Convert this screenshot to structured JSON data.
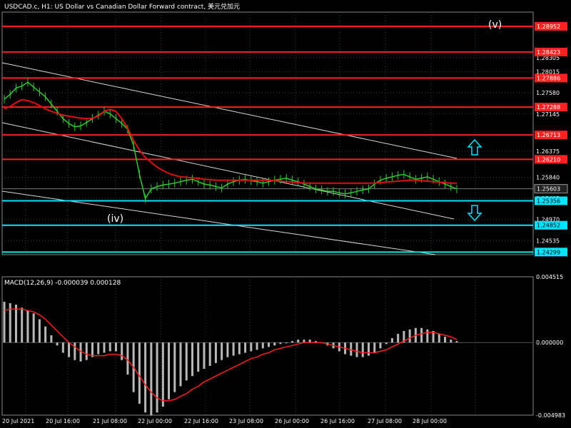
{
  "header": {
    "title": "USDCAD.c, H1:  US Dollar vs Canadian Dollar Forward contract, 美元兑加元"
  },
  "annotations": {
    "wave_v": "(v)",
    "wave_iv": "(iv)"
  },
  "macd": {
    "label": "MACD(12,26,9) -0.000039 0.000128"
  },
  "colors": {
    "background": "#000000",
    "grid": "#3a3a3a",
    "candle_up": "#2ecc2e",
    "ma_line": "#e01010",
    "resistance": "#ff2020",
    "support": "#00e5ff",
    "channel": "#d8d8d8",
    "macd_hist": "#b8b8b8",
    "macd_signal": "#ff2020",
    "text": "#ffffff",
    "arrow": "#00e5ff"
  },
  "chart_data": {
    "type": "line",
    "price_axis": {
      "ticks": [
        "1.28305",
        "1.28015",
        "1.27580",
        "1.27145",
        "1.26375",
        "1.25840",
        "1.25405",
        "1.24970",
        "1.24535"
      ]
    },
    "time_axis": {
      "ticks": [
        "20 Jul 2021",
        "20 Jul 16:00",
        "21 Jul 08:00",
        "22 Jul 00:00",
        "22 Jul 16:00",
        "23 Jul 08:00",
        "26 Jul 00:00",
        "26 Jul 16:00",
        "27 Jul 08:00",
        "28 Jul 00:00"
      ]
    },
    "levels": [
      {
        "value": 1.28952,
        "label": "1.28952",
        "kind": "resistance"
      },
      {
        "value": 1.28423,
        "label": "1.28423",
        "kind": "resistance"
      },
      {
        "value": 1.27886,
        "label": "1.27886",
        "kind": "resistance"
      },
      {
        "value": 1.27288,
        "label": "1.27288",
        "kind": "resistance"
      },
      {
        "value": 1.26713,
        "label": "1.26713",
        "kind": "resistance"
      },
      {
        "value": 1.2621,
        "label": "1.26210",
        "kind": "resistance"
      },
      {
        "value": 1.25356,
        "label": "1.25356",
        "kind": "support"
      },
      {
        "value": 1.24852,
        "label": "1.24852",
        "kind": "support"
      },
      {
        "value": 1.24299,
        "label": "1.24299",
        "kind": "support"
      }
    ],
    "current_price": "1.25603",
    "price_series": [
      1.2745,
      1.2755,
      1.2768,
      1.2772,
      1.278,
      1.277,
      1.276,
      1.275,
      1.2735,
      1.272,
      1.2705,
      1.2695,
      1.2688,
      1.269,
      1.2697,
      1.2705,
      1.2712,
      1.272,
      1.2715,
      1.2705,
      1.2695,
      1.2683,
      1.265,
      1.259,
      1.254,
      1.256,
      1.2565,
      1.2568,
      1.257,
      1.2572,
      1.2575,
      1.2578,
      1.258,
      1.2575,
      1.257,
      1.2568,
      1.2565,
      1.2562,
      1.257,
      1.2575,
      1.2578,
      1.258,
      1.2577,
      1.2575,
      1.2572,
      1.2575,
      1.2578,
      1.258,
      1.2582,
      1.2578,
      1.2575,
      1.257,
      1.2565,
      1.256,
      1.2558,
      1.2555,
      1.2555,
      1.2552,
      1.255,
      1.2552,
      1.2555,
      1.2558,
      1.256,
      1.257,
      1.2578,
      1.2582,
      1.2585,
      1.2588,
      1.259,
      1.2585,
      1.258,
      1.2582,
      1.2585,
      1.258,
      1.2575,
      1.257,
      1.2565,
      1.256
    ],
    "ma_series": [
      1.2725,
      1.273,
      1.2738,
      1.2744,
      1.2742,
      1.2738,
      1.2732,
      1.2725,
      1.272,
      1.2716,
      1.2712,
      1.271,
      1.2708,
      1.2706,
      1.2705,
      1.2706,
      1.271,
      1.272,
      1.2724,
      1.272,
      1.2705,
      1.2685,
      1.266,
      1.264,
      1.2625,
      1.2615,
      1.2605,
      1.2598,
      1.2592,
      1.2588,
      1.2585,
      1.2584,
      1.2583,
      1.2582,
      1.258,
      1.2579,
      1.2578,
      1.2578,
      1.2578,
      1.2578,
      1.2578,
      1.2578,
      1.2578,
      1.2578,
      1.2578,
      1.2578,
      1.2577,
      1.2576,
      1.2575,
      1.2574,
      1.2573,
      1.2572,
      1.2572,
      1.2572,
      1.2572,
      1.2572,
      1.2572,
      1.2572,
      1.2572,
      1.2572,
      1.2572,
      1.2572,
      1.2572,
      1.2572,
      1.2573,
      1.2574,
      1.2575,
      1.2576,
      1.2577,
      1.2578,
      1.2578,
      1.2577,
      1.2576,
      1.2575,
      1.2574,
      1.2573,
      1.2572,
      1.2572
    ],
    "macd_axis": {
      "ticks": [
        "0.004515",
        "0.000000",
        "-0.004983"
      ]
    },
    "macd_hist": [
      0.0028,
      0.0027,
      0.0026,
      0.0024,
      0.0022,
      0.002,
      0.0016,
      0.0011,
      0.0005,
      -0.0002,
      -0.0007,
      -0.001,
      -0.0012,
      -0.0013,
      -0.0012,
      -0.001,
      -0.0008,
      -0.0007,
      -0.0006,
      -0.0006,
      -0.0012,
      -0.0022,
      -0.0034,
      -0.0042,
      -0.0048,
      -0.005,
      -0.0048,
      -0.0044,
      -0.0039,
      -0.0034,
      -0.003,
      -0.0026,
      -0.0023,
      -0.002,
      -0.0018,
      -0.0016,
      -0.0014,
      -0.0012,
      -0.001,
      -0.0009,
      -0.0008,
      -0.0007,
      -0.0006,
      -0.0005,
      -0.0004,
      -0.0003,
      -0.0002,
      -0.0001,
      0.0,
      0.0001,
      0.0002,
      0.0002,
      0.0002,
      0.0001,
      0.0,
      -0.0002,
      -0.0004,
      -0.0006,
      -0.0008,
      -0.0009,
      -0.001,
      -0.001,
      -0.0009,
      -0.0007,
      -0.0004,
      -0.0001,
      0.0003,
      0.0006,
      0.0008,
      0.0009,
      0.001,
      0.001,
      0.0009,
      0.0008,
      0.0006,
      0.0004,
      0.0002,
      0.0001
    ],
    "macd_signal": [
      0.0022,
      0.0023,
      0.0023,
      0.0023,
      0.0022,
      0.0021,
      0.0019,
      0.0016,
      0.0012,
      0.0008,
      0.0004,
      0.0,
      -0.0003,
      -0.0006,
      -0.0008,
      -0.0009,
      -0.0009,
      -0.0009,
      -0.0008,
      -0.0008,
      -0.0009,
      -0.0012,
      -0.0017,
      -0.0023,
      -0.0029,
      -0.0034,
      -0.0038,
      -0.004,
      -0.004,
      -0.0039,
      -0.0037,
      -0.0035,
      -0.0032,
      -0.003,
      -0.0027,
      -0.0025,
      -0.0023,
      -0.0021,
      -0.0019,
      -0.0017,
      -0.0015,
      -0.0013,
      -0.0011,
      -0.001,
      -0.0008,
      -0.0007,
      -0.0005,
      -0.0004,
      -0.0003,
      -0.0002,
      -0.0001,
      0.0,
      0.0,
      0.0,
      0.0,
      -0.0001,
      -0.0002,
      -0.0003,
      -0.0004,
      -0.0005,
      -0.0006,
      -0.0007,
      -0.0007,
      -0.0007,
      -0.0006,
      -0.0005,
      -0.0003,
      -0.0001,
      0.0001,
      0.0003,
      0.0005,
      0.0006,
      0.0007,
      0.0007,
      0.0006,
      0.0005,
      0.0004,
      0.0002
    ]
  }
}
